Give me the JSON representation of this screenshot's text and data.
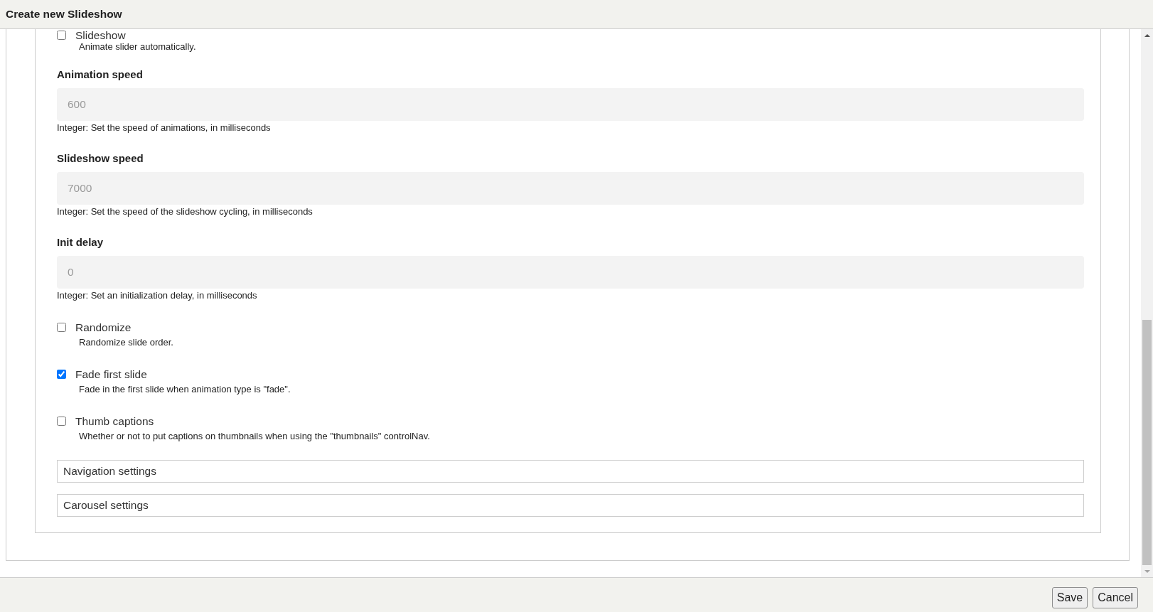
{
  "window": {
    "title": "Create new Slideshow"
  },
  "form": {
    "items": [
      {
        "kind": "checkbox",
        "label": "Slideshow",
        "checked": false,
        "description": "Animate slider automatically."
      },
      {
        "kind": "number",
        "label": "Animation speed",
        "placeholder": "600",
        "help": "Integer: Set the speed of animations, in milliseconds"
      },
      {
        "kind": "number",
        "label": "Slideshow speed",
        "placeholder": "7000",
        "help": "Integer: Set the speed of the slideshow cycling, in milliseconds"
      },
      {
        "kind": "number",
        "label": "Init delay",
        "placeholder": "0",
        "help": "Integer: Set an initialization delay, in milliseconds"
      },
      {
        "kind": "checkbox",
        "label": "Randomize",
        "checked": false,
        "description": "Randomize slide order."
      },
      {
        "kind": "checkbox",
        "label": "Fade first slide",
        "checked": true,
        "description": "Fade in the first slide when animation type is \"fade\"."
      },
      {
        "kind": "checkbox",
        "label": "Thumb captions",
        "checked": false,
        "description": "Whether or not to put captions on thumbnails when using the \"thumbnails\" controlNav."
      }
    ],
    "sections": [
      {
        "title": "Navigation settings"
      },
      {
        "title": "Carousel settings"
      }
    ]
  },
  "buttons": [
    {
      "label": "Save"
    },
    {
      "label": "Cancel"
    }
  ]
}
